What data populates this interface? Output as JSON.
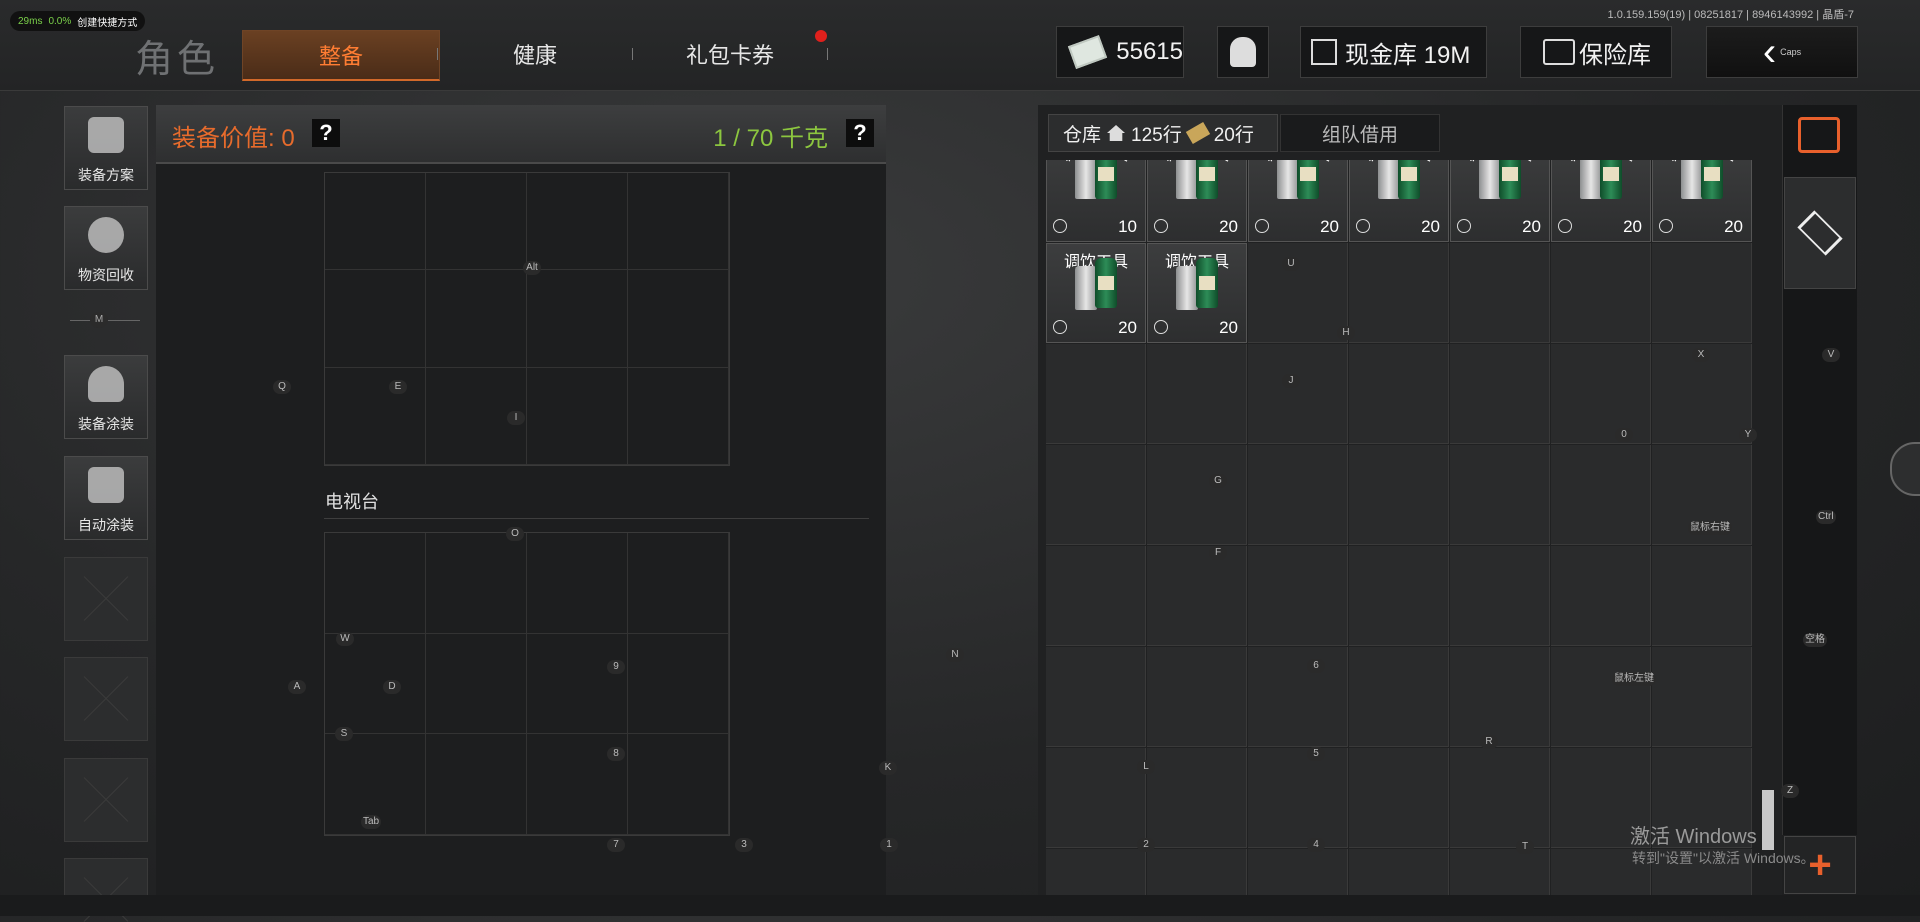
{
  "perf": {
    "ping": "29ms",
    "loss": "0.0%",
    "shortcut": "创建快捷方式"
  },
  "version": "1.0.159.159(19) | 08251817 | 8946143992 | 晶盾-7",
  "header": {
    "title": "角色",
    "tabs": [
      "整备",
      "健康",
      "礼包卡券"
    ],
    "money": "55615",
    "cash_bank": "现金库 19M",
    "safe": "保险库",
    "back_hint": "Caps"
  },
  "sidebar": {
    "items": [
      "装备方案",
      "物资回收",
      "装备涂装",
      "自动涂装"
    ],
    "divider_key": "M"
  },
  "equip": {
    "value_label": "装备价值: 0",
    "weight": "1 / 70 千克",
    "help": "?",
    "tv_label": "电视台"
  },
  "warehouse": {
    "tab_store": "仓库",
    "rows": "125行",
    "cash_rows": "20行",
    "tab_team": "组队借用",
    "item_name": "调饮工具",
    "items": [
      {
        "qty": "10"
      },
      {
        "qty": "20"
      },
      {
        "qty": "20"
      },
      {
        "qty": "20"
      },
      {
        "qty": "20"
      },
      {
        "qty": "20"
      },
      {
        "qty": "20"
      },
      {
        "qty": "20"
      },
      {
        "qty": "20"
      }
    ]
  },
  "keys": {
    "alt": "Alt",
    "q": "Q",
    "e": "E",
    "i": "I",
    "o": "O",
    "w": "W",
    "a": "A",
    "d": "D",
    "s": "S",
    "tab": "Tab",
    "k9": "9",
    "k8": "8",
    "k7": "7",
    "k3": "3",
    "k1": "1",
    "n": "N",
    "k": "K",
    "u": "U",
    "h": "H",
    "j": "J",
    "x": "X",
    "v": "V",
    "k0": "0",
    "y": "Y",
    "g": "G",
    "f": "F",
    "ctrl": "Ctrl",
    "rmb": "鼠标右键",
    "space": "空格",
    "lmb": "鼠标左键",
    "k6": "6",
    "k5": "5",
    "r": "R",
    "l": "L",
    "z": "Z",
    "k2": "2",
    "k4": "4",
    "t": "T"
  },
  "watermark": {
    "line1": "激活 Windows",
    "line2": "转到\"设置\"以激活 Windows。"
  }
}
